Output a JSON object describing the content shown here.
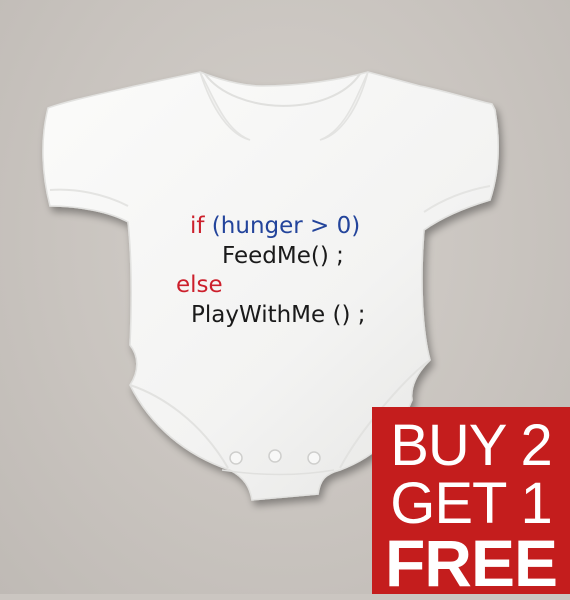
{
  "garment": {
    "code_lines": [
      {
        "parts": [
          {
            "text": "if",
            "role": "keyword"
          },
          {
            "text": " (hunger > 0)",
            "role": "condition"
          }
        ]
      },
      {
        "parts": [
          {
            "text": "FeedMe() ;",
            "role": "call"
          }
        ]
      },
      {
        "parts": [
          {
            "text": "else",
            "role": "keyword"
          }
        ]
      },
      {
        "parts": [
          {
            "text": "PlayWithMe () ;",
            "role": "call"
          }
        ]
      }
    ],
    "colors": {
      "keyword": "#cc1f2b",
      "condition": "#23449b",
      "call": "#1a1a1a",
      "fabric": "#f7f7f6"
    }
  },
  "promo": {
    "line1": "BUY 2",
    "line2": "GET 1",
    "line3": "FREE",
    "background": "#c41d1d",
    "text_color": "#ffffff"
  }
}
